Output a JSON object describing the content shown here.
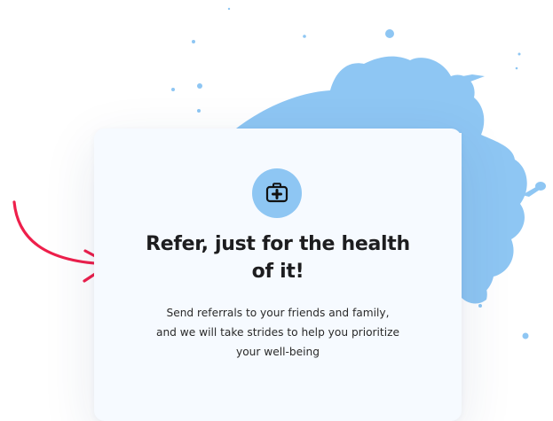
{
  "card": {
    "icon": "medical-kit-icon",
    "title_line1": "Refer, just for the health",
    "title_line2": "of it!",
    "description_line1": "Send referrals to your friends and family,",
    "description_line2": "and we will take strides to help you prioritize",
    "description_line3": "your well-being"
  },
  "colors": {
    "splash": "#8ec6f3",
    "arrow": "#ee1f4b",
    "card_background": "#f6faff",
    "title_text": "#1d1d1f"
  }
}
